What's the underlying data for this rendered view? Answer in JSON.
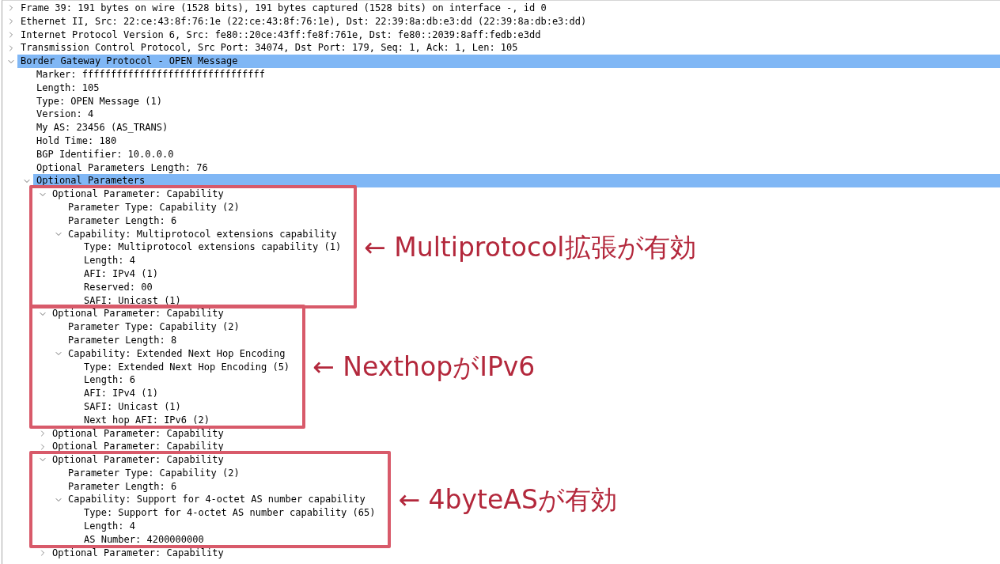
{
  "tree": [
    {
      "text": "Frame 39: 191 bytes on wire (1528 bits), 191 bytes captured (1528 bits) on interface -, id 0",
      "expanded": false,
      "selected": false
    },
    {
      "text": "Ethernet II, Src: 22:ce:43:8f:76:1e (22:ce:43:8f:76:1e), Dst: 22:39:8a:db:e3:dd (22:39:8a:db:e3:dd)",
      "expanded": false,
      "selected": false
    },
    {
      "text": "Internet Protocol Version 6, Src: fe80::20ce:43ff:fe8f:761e, Dst: fe80::2039:8aff:fedb:e3dd",
      "expanded": false,
      "selected": false
    },
    {
      "text": "Transmission Control Protocol, Src Port: 34074, Dst Port: 179, Seq: 1, Ack: 1, Len: 105",
      "expanded": false,
      "selected": false
    },
    {
      "text": "Border Gateway Protocol - OPEN Message",
      "expanded": true,
      "selected": true,
      "children": [
        {
          "text": "Marker: ffffffffffffffffffffffffffffffff",
          "selected": false
        },
        {
          "text": "Length: 105",
          "selected": false
        },
        {
          "text": "Type: OPEN Message (1)",
          "selected": false
        },
        {
          "text": "Version: 4",
          "selected": false
        },
        {
          "text": "My AS: 23456 (AS_TRANS)",
          "selected": false
        },
        {
          "text": "Hold Time: 180",
          "selected": false
        },
        {
          "text": "BGP Identifier: 10.0.0.0",
          "selected": false
        },
        {
          "text": "Optional Parameters Length: 76",
          "selected": false
        },
        {
          "text": "Optional Parameters",
          "expanded": true,
          "selected": true,
          "children": [
            {
              "text": "Optional Parameter: Capability",
              "expanded": true,
              "selected": false,
              "annotation": "← Multiprotocol拡張が有効",
              "children": [
                {
                  "text": "Parameter Type: Capability (2)",
                  "selected": false
                },
                {
                  "text": "Parameter Length: 6",
                  "selected": false
                },
                {
                  "text": "Capability: Multiprotocol extensions capability",
                  "expanded": true,
                  "selected": false,
                  "children": [
                    {
                      "text": "Type: Multiprotocol extensions capability (1)",
                      "selected": false
                    },
                    {
                      "text": "Length: 4",
                      "selected": false
                    },
                    {
                      "text": "AFI: IPv4 (1)",
                      "selected": false
                    },
                    {
                      "text": "Reserved: 00",
                      "selected": false
                    },
                    {
                      "text": "SAFI: Unicast (1)",
                      "selected": false
                    }
                  ]
                }
              ]
            },
            {
              "text": "Optional Parameter: Capability",
              "expanded": true,
              "selected": false,
              "annotation": "← NexthopがIPv6",
              "children": [
                {
                  "text": "Parameter Type: Capability (2)",
                  "selected": false
                },
                {
                  "text": "Parameter Length: 8",
                  "selected": false
                },
                {
                  "text": "Capability: Extended Next Hop Encoding",
                  "expanded": true,
                  "selected": false,
                  "children": [
                    {
                      "text": "Type: Extended Next Hop Encoding (5)",
                      "selected": false
                    },
                    {
                      "text": "Length: 6",
                      "selected": false
                    },
                    {
                      "text": "AFI: IPv4 (1)",
                      "selected": false
                    },
                    {
                      "text": "SAFI: Unicast (1)",
                      "selected": false
                    },
                    {
                      "text": "Next hop AFI: IPv6 (2)",
                      "selected": false
                    }
                  ]
                }
              ]
            },
            {
              "text": "Optional Parameter: Capability",
              "expanded": false,
              "selected": false
            },
            {
              "text": "Optional Parameter: Capability",
              "expanded": false,
              "selected": false
            },
            {
              "text": "Optional Parameter: Capability",
              "expanded": true,
              "selected": false,
              "annotation": "← 4byteASが有効",
              "children": [
                {
                  "text": "Parameter Type: Capability (2)",
                  "selected": false
                },
                {
                  "text": "Parameter Length: 6",
                  "selected": false
                },
                {
                  "text": "Capability: Support for 4-octet AS number capability",
                  "expanded": true,
                  "selected": false,
                  "children": [
                    {
                      "text": "Type: Support for 4-octet AS number capability (65)",
                      "selected": false
                    },
                    {
                      "text": "Length: 4",
                      "selected": false
                    },
                    {
                      "text": "AS Number: 4200000000",
                      "selected": false
                    }
                  ]
                }
              ]
            },
            {
              "text": "Optional Parameter: Capability",
              "expanded": false,
              "selected": false
            }
          ]
        }
      ]
    }
  ]
}
